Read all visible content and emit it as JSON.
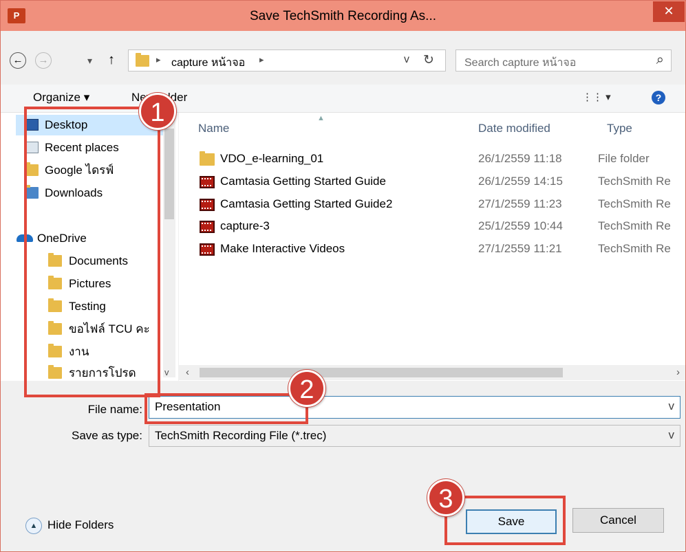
{
  "window": {
    "title": "Save TechSmith Recording As...",
    "app_icon": "P",
    "close_glyph": "✕"
  },
  "nav": {
    "back": "←",
    "forward": "→",
    "recent": "▾",
    "up": "↑",
    "breadcrumb_sep": "▸",
    "path": "capture หน้าจอ",
    "refresh": "↻",
    "dropdown": "v",
    "search_placeholder": "Search capture หน้าจอ",
    "search_glyph": "⌕"
  },
  "toolbar": {
    "organize": "Organize ▾",
    "new_folder": "New folder",
    "view_glyph": "⋮⋮ ▾",
    "help": "?"
  },
  "sidebar": {
    "items": [
      {
        "label": "Desktop",
        "icon": "desktop-icon"
      },
      {
        "label": "Recent places",
        "icon": "recent-places-icon"
      },
      {
        "label": "Google ไดรฟ์",
        "icon": "google-drive-icon"
      },
      {
        "label": "Downloads",
        "icon": "downloads-icon"
      },
      {
        "label": "OneDrive",
        "icon": "onedrive-icon"
      },
      {
        "label": "Documents",
        "icon": "folder-icon"
      },
      {
        "label": "Pictures",
        "icon": "folder-icon"
      },
      {
        "label": "Testing",
        "icon": "folder-icon"
      },
      {
        "label": "ขอไฟล์ TCU คะ",
        "icon": "folder-icon"
      },
      {
        "label": "งาน",
        "icon": "folder-icon"
      },
      {
        "label": "รายการโปรด",
        "icon": "folder-icon"
      }
    ]
  },
  "columns": {
    "name": "Name",
    "date": "Date modified",
    "type": "Type"
  },
  "files": [
    {
      "name": "VDO_e-learning_01",
      "date": "26/1/2559 11:18",
      "type": "File folder",
      "icon": "folder-icon"
    },
    {
      "name": "Camtasia Getting Started Guide",
      "date": "26/1/2559 14:15",
      "type": "TechSmith Re",
      "icon": "recording-file-icon"
    },
    {
      "name": "Camtasia Getting Started Guide2",
      "date": "27/1/2559 11:23",
      "type": "TechSmith Re",
      "icon": "recording-file-icon"
    },
    {
      "name": "capture-3",
      "date": "25/1/2559 10:44",
      "type": "TechSmith Re",
      "icon": "recording-file-icon"
    },
    {
      "name": "Make Interactive Videos",
      "date": "27/1/2559 11:21",
      "type": "TechSmith Re",
      "icon": "recording-file-icon"
    }
  ],
  "form": {
    "file_name_label": "File name:",
    "file_name_value": "Presentation",
    "save_type_label": "Save as type:",
    "save_type_value": "TechSmith Recording File (*.trec)",
    "combo_arrow": "v"
  },
  "footer": {
    "hide_folders": "Hide Folders",
    "hide_glyph": "▲",
    "save": "Save",
    "cancel": "Cancel"
  },
  "callouts": {
    "one": "1",
    "two": "2",
    "three": "3"
  },
  "colors": {
    "accent_red": "#e0483c",
    "badge_red": "#d03b33",
    "titlebar": "#f0907d"
  }
}
